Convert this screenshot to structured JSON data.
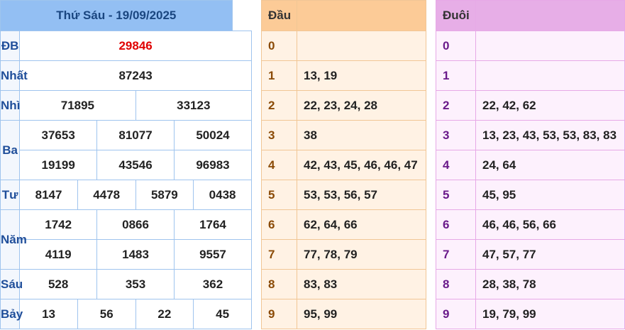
{
  "results": {
    "title": "Thứ Sáu - 19/09/2025",
    "prizes": [
      {
        "label": "ĐB",
        "rows": [
          [
            "29846"
          ]
        ]
      },
      {
        "label": "Nhất",
        "rows": [
          [
            "87243"
          ]
        ]
      },
      {
        "label": "Nhì",
        "rows": [
          [
            "71895",
            "33123"
          ]
        ]
      },
      {
        "label": "Ba",
        "rows": [
          [
            "37653",
            "81077",
            "50024"
          ],
          [
            "19199",
            "43546",
            "96983"
          ]
        ]
      },
      {
        "label": "Tư",
        "rows": [
          [
            "8147",
            "4478",
            "5879",
            "0438"
          ]
        ]
      },
      {
        "label": "Năm",
        "rows": [
          [
            "1742",
            "0866",
            "1764"
          ],
          [
            "4119",
            "1483",
            "9557"
          ]
        ]
      },
      {
        "label": "Sáu",
        "rows": [
          [
            "528",
            "353",
            "362"
          ]
        ]
      },
      {
        "label": "Bảy",
        "rows": [
          [
            "13",
            "56",
            "22",
            "45"
          ]
        ]
      }
    ]
  },
  "dau": {
    "header": "Đầu",
    "rows": [
      {
        "digit": "0",
        "values": ""
      },
      {
        "digit": "1",
        "values": "13, 19"
      },
      {
        "digit": "2",
        "values": "22, 23, 24, 28"
      },
      {
        "digit": "3",
        "values": "38"
      },
      {
        "digit": "4",
        "values": "42, 43, 45, 46, 46, 47"
      },
      {
        "digit": "5",
        "values": "53, 53, 56, 57"
      },
      {
        "digit": "6",
        "values": "62, 64, 66"
      },
      {
        "digit": "7",
        "values": "77, 78, 79"
      },
      {
        "digit": "8",
        "values": "83, 83"
      },
      {
        "digit": "9",
        "values": "95, 99"
      }
    ]
  },
  "duoi": {
    "header": "Đuôi",
    "rows": [
      {
        "digit": "0",
        "values": ""
      },
      {
        "digit": "1",
        "values": ""
      },
      {
        "digit": "2",
        "values": "22, 42, 62"
      },
      {
        "digit": "3",
        "values": "13, 23, 43, 53, 53, 83, 83"
      },
      {
        "digit": "4",
        "values": "24, 64"
      },
      {
        "digit": "5",
        "values": "45, 95"
      },
      {
        "digit": "6",
        "values": "46, 46, 56, 66"
      },
      {
        "digit": "7",
        "values": "47, 57, 77"
      },
      {
        "digit": "8",
        "values": "28, 38, 78"
      },
      {
        "digit": "9",
        "values": "19, 79, 99"
      }
    ]
  }
}
